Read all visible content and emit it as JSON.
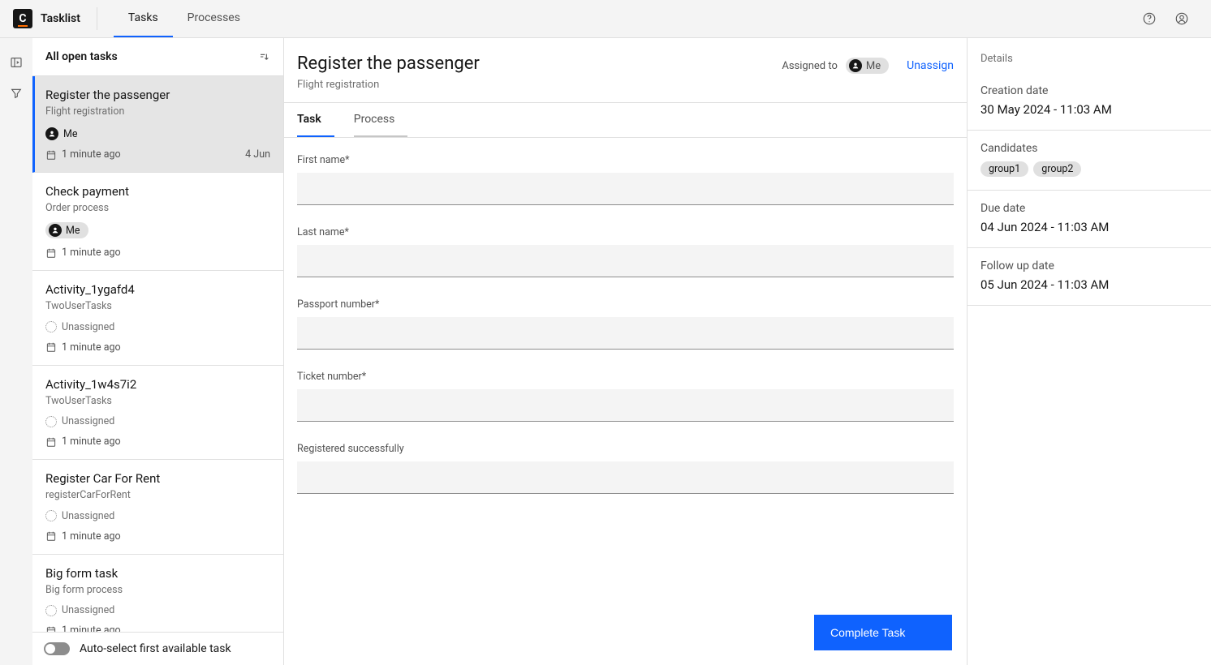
{
  "header": {
    "brand_initial": "C",
    "brand_name": "Tasklist",
    "tabs": [
      {
        "label": "Tasks",
        "active": true
      },
      {
        "label": "Processes",
        "active": false
      }
    ]
  },
  "tasklist": {
    "heading": "All open tasks",
    "auto_select_label": "Auto-select first available task",
    "assignee_me": "Me",
    "unassigned_label": "Unassigned",
    "items": [
      {
        "title": "Register the passenger",
        "process": "Flight registration",
        "assignee": "me",
        "age": "1 minute ago",
        "due": "4 Jun",
        "selected": true
      },
      {
        "title": "Check payment",
        "process": "Order process",
        "assignee": "me-pill",
        "age": "1 minute ago",
        "due": ""
      },
      {
        "title": "Activity_1ygafd4",
        "process": "TwoUserTasks",
        "assignee": "unassigned",
        "age": "1 minute ago",
        "due": ""
      },
      {
        "title": "Activity_1w4s7i2",
        "process": "TwoUserTasks",
        "assignee": "unassigned",
        "age": "1 minute ago",
        "due": ""
      },
      {
        "title": "Register Car For Rent",
        "process": "registerCarForRent",
        "assignee": "unassigned",
        "age": "1 minute ago",
        "due": ""
      },
      {
        "title": "Big form task",
        "process": "Big form process",
        "assignee": "unassigned",
        "age": "1 minute ago",
        "due": ""
      }
    ]
  },
  "main": {
    "title": "Register the passenger",
    "subtitle": "Flight registration",
    "assigned_label": "Assigned to",
    "assignee": "Me",
    "unassign_label": "Unassign",
    "subtabs": [
      {
        "label": "Task",
        "active": true
      },
      {
        "label": "Process",
        "active": false
      }
    ],
    "fields": [
      {
        "label": "First name*"
      },
      {
        "label": "Last name*"
      },
      {
        "label": "Passport number*"
      },
      {
        "label": "Ticket number*"
      },
      {
        "label": "Registered successfully"
      }
    ],
    "complete_label": "Complete Task"
  },
  "details": {
    "heading": "Details",
    "creation": {
      "label": "Creation date",
      "value": "30 May 2024 - 11:03 AM"
    },
    "candidates": {
      "label": "Candidates",
      "values": [
        "group1",
        "group2"
      ]
    },
    "due": {
      "label": "Due date",
      "value": "04 Jun 2024 - 11:03 AM"
    },
    "followup": {
      "label": "Follow up date",
      "value": "05 Jun 2024 - 11:03 AM"
    }
  }
}
